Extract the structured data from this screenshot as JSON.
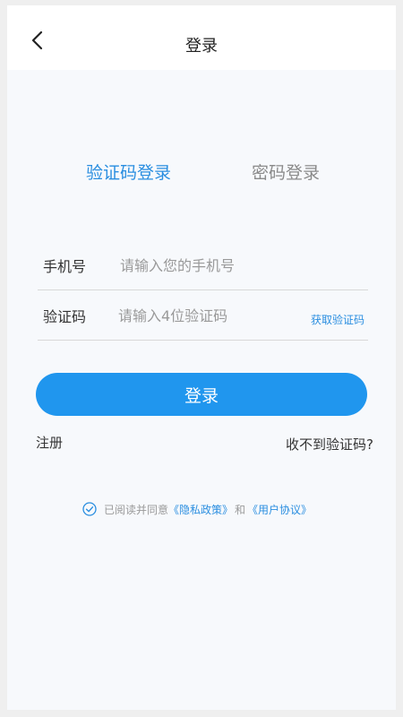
{
  "header": {
    "title": "登录",
    "back_icon": "chevron-left-icon"
  },
  "tabs": [
    {
      "label": "验证码登录",
      "active": true
    },
    {
      "label": "密码登录",
      "active": false
    }
  ],
  "form": {
    "phone": {
      "label": "手机号",
      "placeholder": "请输入您的手机号",
      "value": ""
    },
    "code": {
      "label": "验证码",
      "placeholder": "请输入4位验证码",
      "value": "",
      "get_code_label": "获取验证码"
    }
  },
  "actions": {
    "login_label": "登录",
    "register_label": "注册",
    "no_code_label": "收不到验证码?"
  },
  "agreement": {
    "checked": true,
    "prefix": "已阅读并同意",
    "privacy_link": "《隐私政策》",
    "and": "和",
    "user_link": "《用户协议》"
  },
  "colors": {
    "accent": "#2096ee",
    "link": "#2a8ee0",
    "background": "#f7f9fc"
  }
}
